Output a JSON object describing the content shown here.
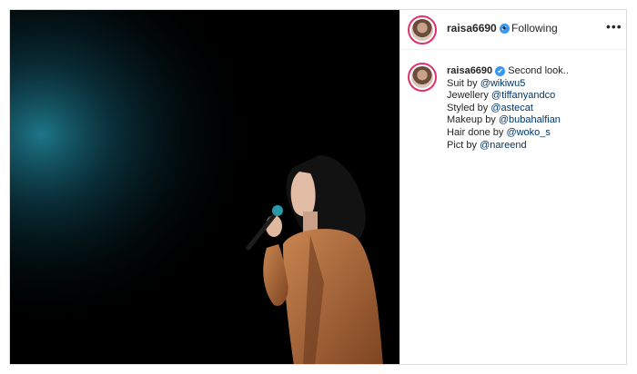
{
  "post": {
    "username": "raisa6690",
    "separator": "•",
    "follow_status": "Following",
    "more_label": "•••",
    "verified_mark": "✔",
    "caption": {
      "first_line": "Second look..",
      "lines": [
        {
          "prefix": "Suit by ",
          "mention": "@wikiwu5"
        },
        {
          "prefix": "Jewellery ",
          "mention": "@tiffanyandco"
        },
        {
          "prefix": "Styled by ",
          "mention": "@astecat"
        },
        {
          "prefix": "Makeup by ",
          "mention": "@bubahalfian"
        },
        {
          "prefix": "Hair done by ",
          "mention": "@woko_s"
        },
        {
          "prefix": "Pict by ",
          "mention": "@nareend"
        }
      ]
    }
  },
  "colors": {
    "link": "#00376b",
    "verified": "#3897f0",
    "story_ring": "#e1306c",
    "spotlight": "#1f7c8f",
    "suit": "#b2683a"
  },
  "icons": {
    "avatar": "avatar",
    "verified": "verified-icon",
    "more": "more-options-icon",
    "microphone": "microphone"
  }
}
